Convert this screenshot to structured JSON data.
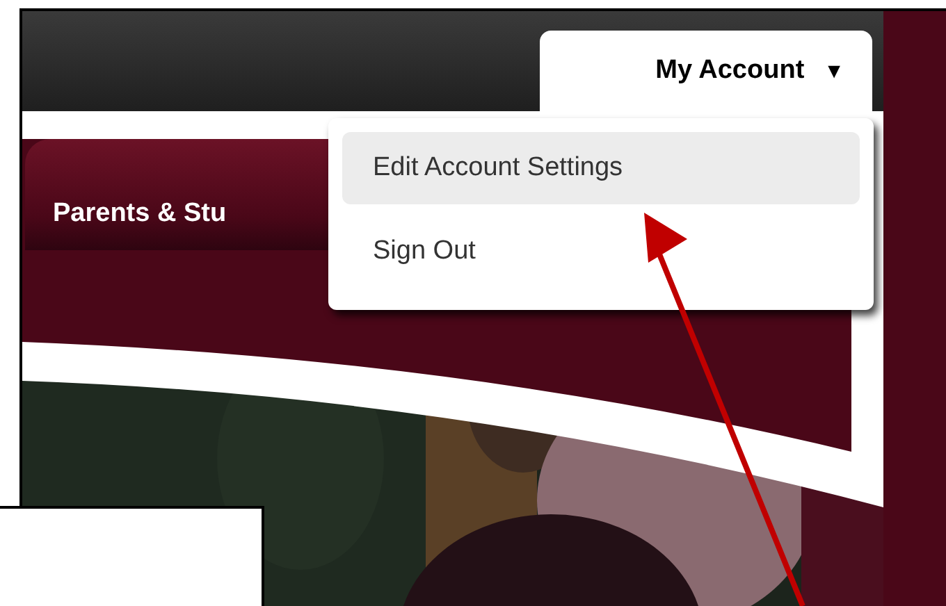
{
  "account_menu": {
    "label": "My Account",
    "caret": "▼",
    "expanded": true,
    "items": [
      {
        "label": "Edit Account Settings",
        "selected": true
      },
      {
        "label": "Sign Out",
        "selected": false
      }
    ]
  },
  "tabs": [
    {
      "label": "Parents & Stu",
      "selected": true
    }
  ],
  "annotation": {
    "kind": "arrow"
  }
}
